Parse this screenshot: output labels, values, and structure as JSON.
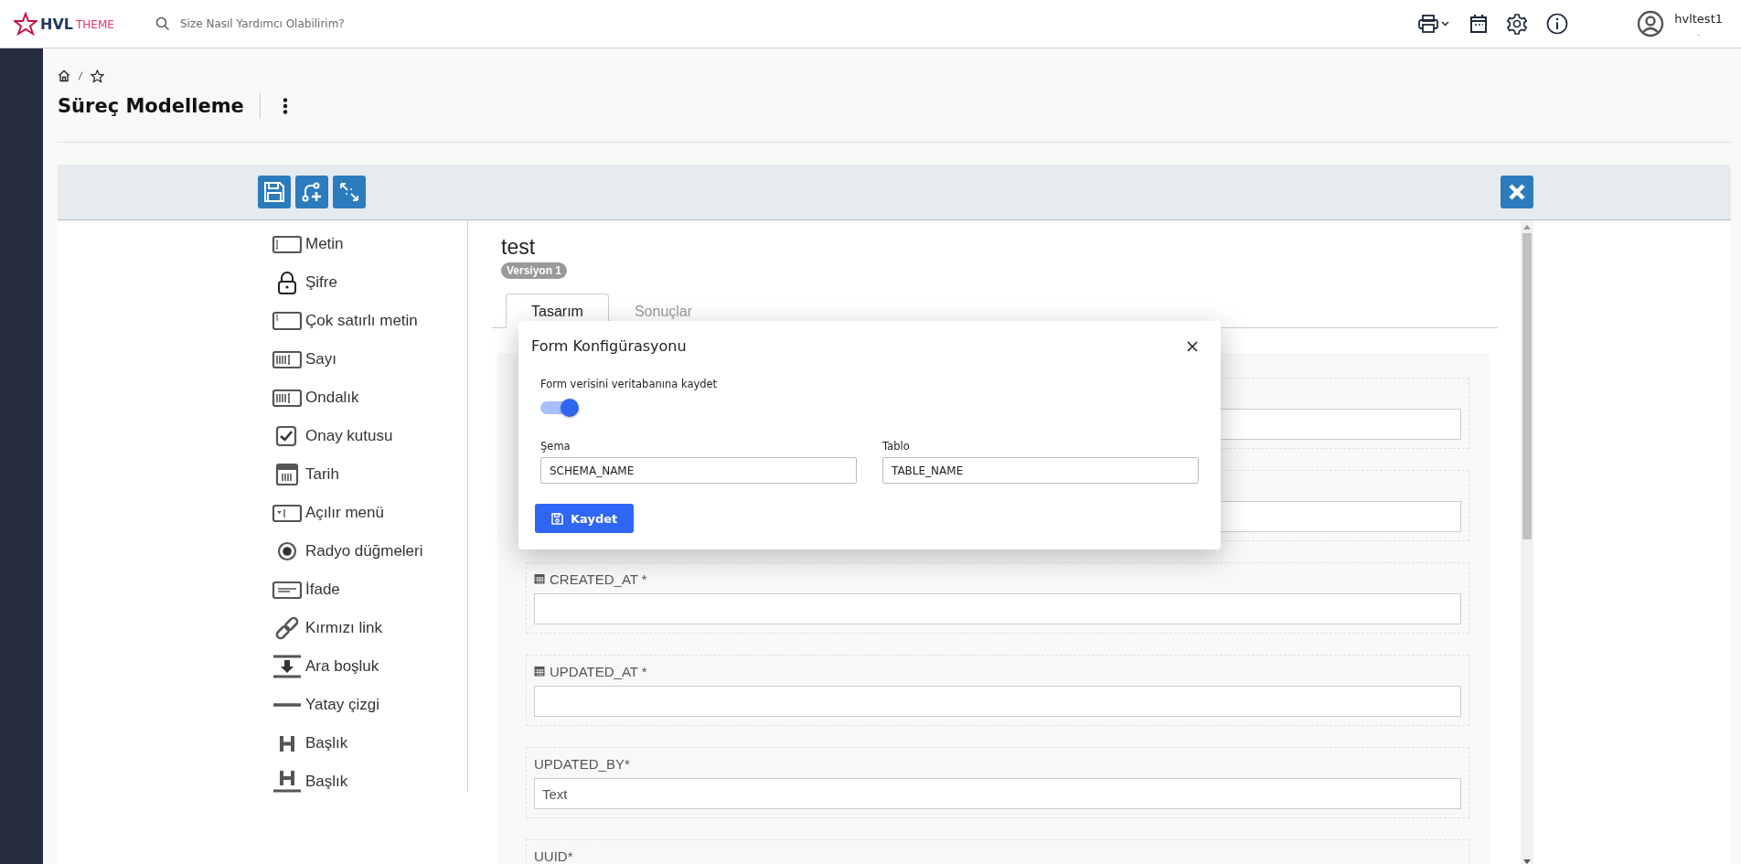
{
  "header": {
    "logo": {
      "brand": "HVL",
      "suffix": "THEME"
    },
    "search": {
      "placeholder": "Size Nasıl Yardımcı Olabilirim?"
    },
    "user": {
      "name": "hvltest1",
      "subtitle": "-"
    }
  },
  "page": {
    "title": "Süreç Modelleme"
  },
  "palette": [
    {
      "kind": "text",
      "label": "Metin"
    },
    {
      "kind": "password",
      "label": "Şifre"
    },
    {
      "kind": "textarea",
      "label": "Çok satırlı metin"
    },
    {
      "kind": "number",
      "label": "Sayı"
    },
    {
      "kind": "decimal",
      "label": "Ondalık"
    },
    {
      "kind": "checkbox",
      "label": "Onay kutusu"
    },
    {
      "kind": "date",
      "label": "Tarih"
    },
    {
      "kind": "select",
      "label": "Açılır menü"
    },
    {
      "kind": "radio",
      "label": "Radyo düğmeleri"
    },
    {
      "kind": "paragraph",
      "label": "İfade"
    },
    {
      "kind": "link",
      "label": "Kırmızı link"
    },
    {
      "kind": "spacer",
      "label": "Ara boşluk"
    },
    {
      "kind": "rule",
      "label": "Yatay çizgi"
    },
    {
      "kind": "heading",
      "label": "Başlık"
    },
    {
      "kind": "heading-underline",
      "label": "Başlık"
    }
  ],
  "form": {
    "name": "test",
    "version": "Versiyon 1",
    "tabs": [
      {
        "label": "Tasarım",
        "selected": true
      },
      {
        "label": "Sonuçlar",
        "selected": false
      }
    ],
    "fields": [
      {
        "kind": "text"
      },
      {
        "kind": "text"
      },
      {
        "kind": "date",
        "label": "CREATED_AT *"
      },
      {
        "kind": "date",
        "label": "UPDATED_AT *"
      },
      {
        "kind": "text",
        "label": "UPDATED_BY*",
        "value": "Text"
      },
      {
        "kind": "text",
        "label": "UUID*",
        "input": false
      }
    ]
  },
  "dialog": {
    "title": "Form Konfigürasyonu",
    "toggle": {
      "label": "Form verisini veritabanına kaydet",
      "on": true
    },
    "inputs": [
      {
        "label": "Şema",
        "value": "SCHEMA_NAME"
      },
      {
        "label": "Tablo",
        "value": "TABLE_NAME"
      }
    ],
    "button": "Kaydet"
  }
}
